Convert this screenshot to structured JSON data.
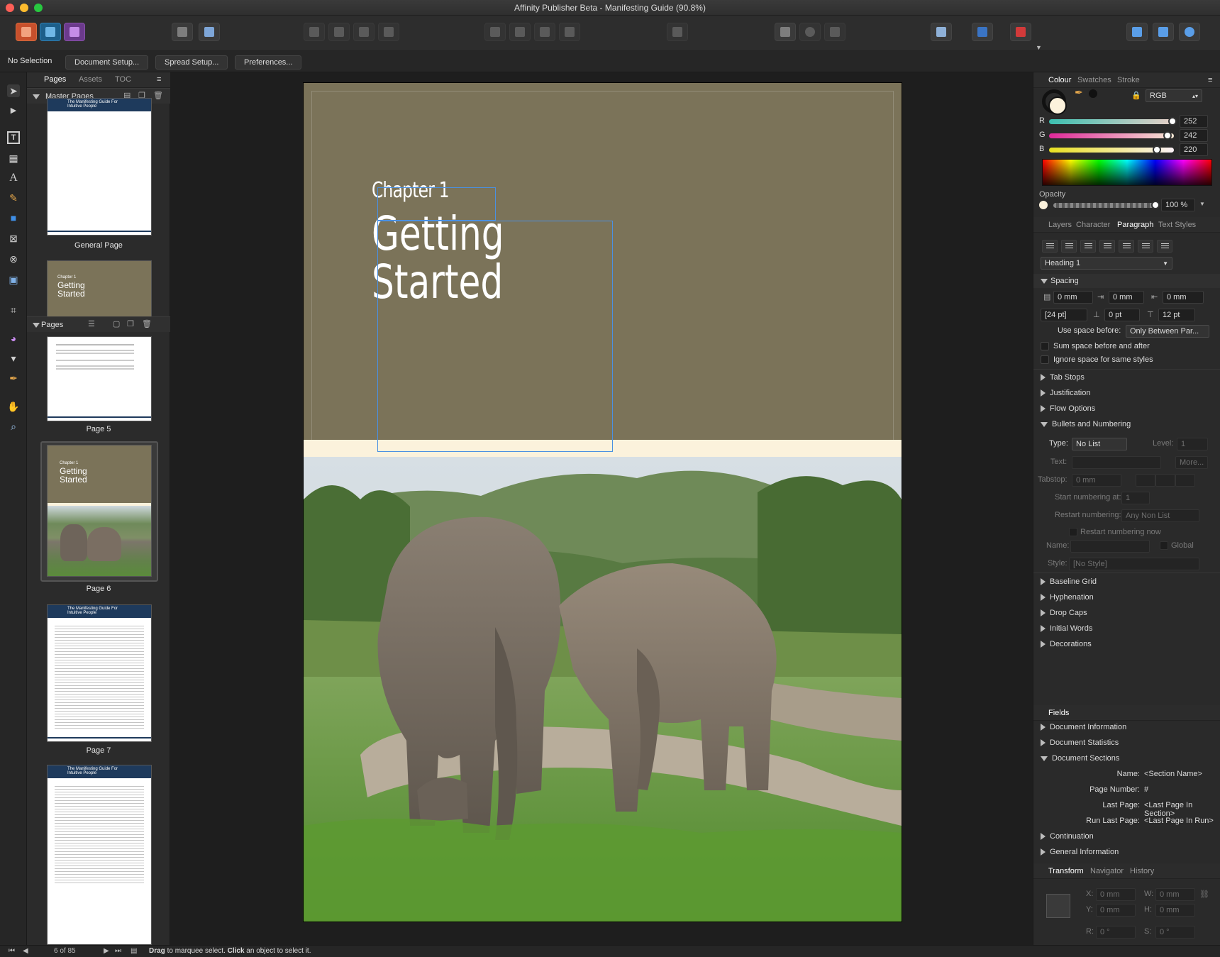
{
  "window": {
    "title": "Affinity Publisher Beta - Manifesting Guide (90.8%)"
  },
  "context_bar": {
    "selection": "No Selection",
    "document_setup": "Document Setup...",
    "spread_setup": "Spread Setup...",
    "preferences": "Preferences..."
  },
  "pages_panel": {
    "tabs": [
      "Pages",
      "Assets",
      "TOC"
    ],
    "master_header": "Master Pages",
    "pages_header": "Pages",
    "master_pages": [
      {
        "label": "General Page"
      }
    ],
    "thumb_texts": {
      "header_title": "The Manifesting Guide For Intuitive People",
      "chapter": "Chapter 1",
      "getting": "Getting",
      "started": "Started"
    },
    "pages": [
      {
        "label": "Page 5"
      },
      {
        "label": "Page 6"
      },
      {
        "label": "Page 7"
      }
    ]
  },
  "document": {
    "chapter": "Chapter 1",
    "heading_line1": "Getting",
    "heading_line2": "Started",
    "colors": {
      "band": "#7b7359",
      "strip": "#fbf2dc"
    }
  },
  "colour_panel": {
    "tabs": [
      "Colour",
      "Swatches",
      "Stroke"
    ],
    "model": "RGB",
    "channels": [
      {
        "name": "R",
        "value": "252",
        "level": 0.988
      },
      {
        "name": "G",
        "value": "242",
        "level": 0.949
      },
      {
        "name": "B",
        "value": "220",
        "level": 0.863
      }
    ],
    "opacity_label": "Opacity",
    "opacity_value": "100 %",
    "fill_color": "#fcf2dc"
  },
  "paragraph_panel": {
    "tabs": [
      "Layers",
      "Character",
      "Paragraph",
      "Text Styles"
    ],
    "style": "Heading 1",
    "spacing_header": "Spacing",
    "left_indent": "0 mm",
    "first_indent": "0 mm",
    "right_indent": "0 mm",
    "leading": "[24 pt]",
    "space_before": "0 pt",
    "space_after": "12 pt",
    "use_space_before_label": "Use space before:",
    "use_space_before_value": "Only Between Par...",
    "sum_space": "Sum space before and after",
    "ignore_space": "Ignore space for same styles",
    "sections_a": [
      "Tab Stops",
      "Justification",
      "Flow Options"
    ],
    "bullets_header": "Bullets and Numbering",
    "bullets": {
      "type_label": "Type:",
      "type_value": "No List",
      "level_label": "Level:",
      "level_value": "1",
      "text_label": "Text:",
      "more": "More...",
      "tabstop_label": "Tabstop:",
      "tabstop_value": "0 mm",
      "start_label": "Start numbering at:",
      "start_value": "1",
      "restart_label": "Restart numbering:",
      "restart_value": "Any Non List",
      "restart_now": "Restart numbering now",
      "name_label": "Name:",
      "global": "Global",
      "style_label": "Style:",
      "style_value": "[No Style]"
    },
    "sections_b": [
      "Baseline Grid",
      "Hyphenation",
      "Drop Caps",
      "Initial Words",
      "Decorations"
    ]
  },
  "fields_panel": {
    "tab": "Fields",
    "sections": [
      "Document Information",
      "Document Statistics"
    ],
    "expanded": "Document Sections",
    "rows": [
      {
        "label": "Name:",
        "value": "<Section Name>"
      },
      {
        "label": "Page Number:",
        "value": "#"
      },
      {
        "label": "Last Page:",
        "value": "<Last Page In Section>"
      },
      {
        "label": "Run Last Page:",
        "value": "<Last Page In Run>"
      }
    ],
    "sections_after": [
      "Continuation",
      "General Information"
    ]
  },
  "transform_panel": {
    "tabs": [
      "Transform",
      "Navigator",
      "History"
    ],
    "x": "0 mm",
    "y": "0 mm",
    "w": "0 mm",
    "h": "0 mm",
    "r": "0 °",
    "s": "0 °"
  },
  "status": {
    "page": "6 of 85",
    "hint_drag": "Drag",
    "hint_mid": " to marquee select. ",
    "hint_click": "Click",
    "hint_end": " an object to select it."
  }
}
